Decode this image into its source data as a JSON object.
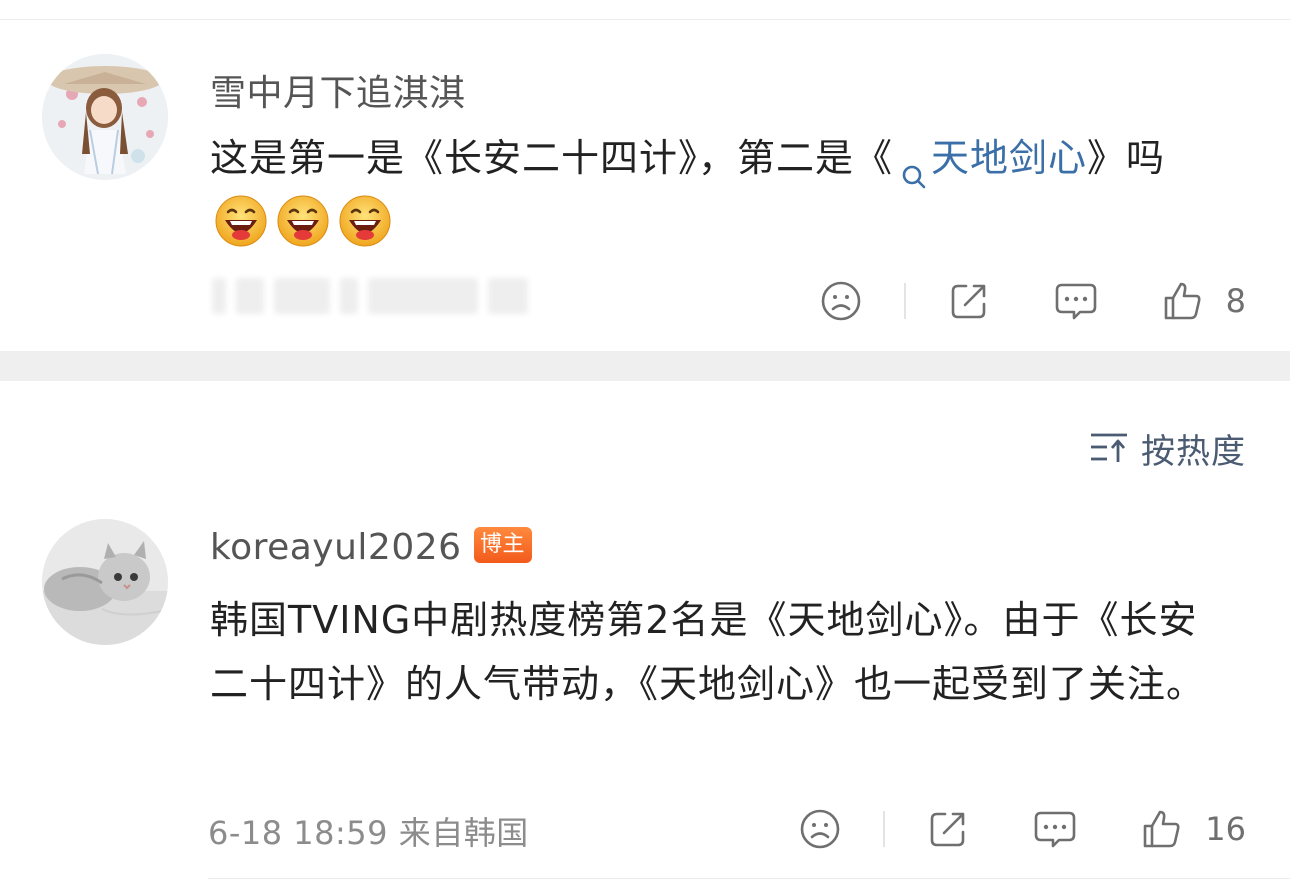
{
  "comments": [
    {
      "username": "雪中月下追淇淇",
      "text_before": "这是第一是《长安二十四计》，第二是《",
      "topic_link": "天地剑心",
      "text_after": "》吗",
      "emoji_count": 3,
      "emoji_name": "laughing-emoji",
      "like_count": "8"
    },
    {
      "username": "koreayul2026",
      "badge": "博主",
      "text": "韩国TVING中剧热度榜第2名是《天地剑心》。由于《长安二十四计》的人气带动，《天地剑心》也一起受到了关注。",
      "timestamp": "6-18 18:59",
      "location": "来自韩国",
      "like_count": "16"
    }
  ],
  "sort": {
    "label": "按热度",
    "icon": "sort-icon"
  },
  "icons": {
    "dislike": "sad-face-icon",
    "share": "share-icon",
    "reply": "comment-bubble-icon",
    "like": "thumbs-up-icon"
  },
  "colors": {
    "link": "#3b6fa8",
    "badge": "#f25a1b",
    "divider_band": "#efefef",
    "meta_text": "#8c8c8c"
  }
}
